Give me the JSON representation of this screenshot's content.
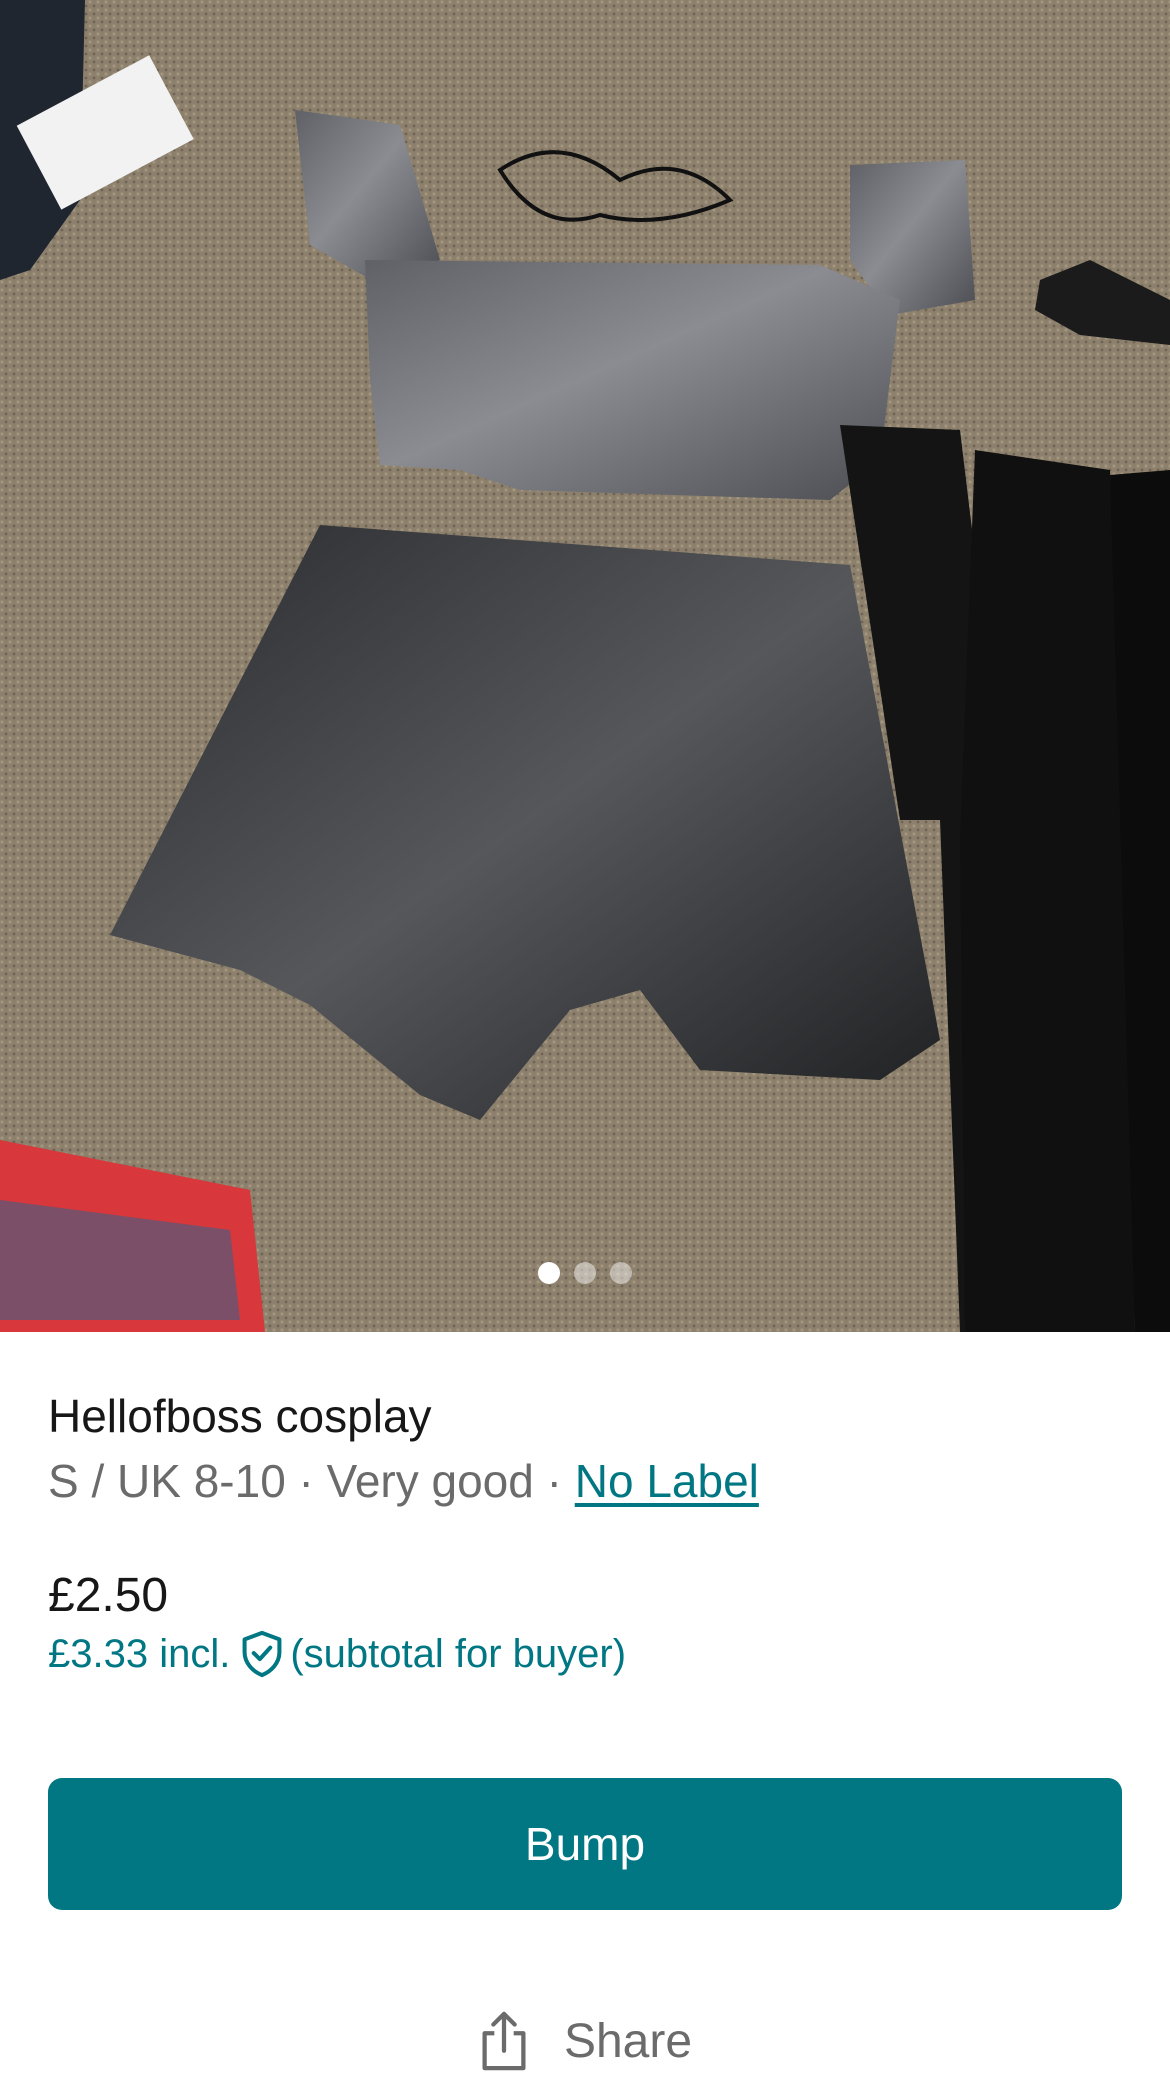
{
  "gallery": {
    "image_alt": "Grey satin crop top and black shorts laid out on a carpet",
    "pages": 3,
    "current_page": 1
  },
  "item": {
    "title": "Hellofboss cosplay",
    "size": "S / UK 8-10",
    "separator": " · ",
    "condition": "Very good",
    "brand": "No Label"
  },
  "pricing": {
    "price": "£2.50",
    "buyer_total": "£3.33 incl.",
    "buyer_note": "(subtotal for buyer)"
  },
  "actions": {
    "bump_label": "Bump",
    "share_label": "Share"
  },
  "colors": {
    "accent": "#007782",
    "text_primary": "#171717",
    "text_secondary": "#6b6b6b"
  },
  "icons": {
    "buyer_protection": "shield-check-icon",
    "share": "share-icon"
  }
}
